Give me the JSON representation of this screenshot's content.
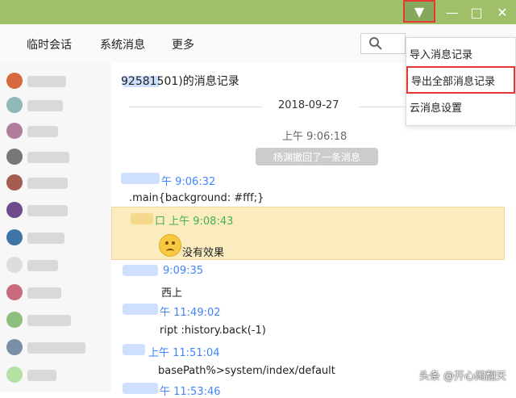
{
  "toolbar": {
    "tabs": [
      "临时会话",
      "系统消息",
      "更多"
    ]
  },
  "chat": {
    "title": "92581501)的消息记录",
    "date": "2018-09-27",
    "recall_time": "上午 9:06:18",
    "recall_text": "杨渊撤回了一条消息",
    "messages": [
      {
        "time": "午 9:06:32",
        "text": ".main{background: #fff;}"
      },
      {
        "time": "口 上午 9:08:43",
        "text": "没有效果",
        "highlight": true
      },
      {
        "time": "9:09:35",
        "text": "西上"
      },
      {
        "time": "午 11:49:02",
        "text": "ript :history.back(-1)"
      },
      {
        "time": "上午 11:51:04",
        "text": "basePath%>system/index/default"
      },
      {
        "time": "午 11:53:46",
        "text": ""
      }
    ]
  },
  "menu": {
    "items": [
      "导入消息记录",
      "导出全部消息记录",
      "云消息设置"
    ]
  },
  "watermark": "头条 @开心闹翻天",
  "icons": {
    "dropdown": "dropdown-arrow-icon",
    "minimize": "minimize-icon",
    "maximize": "maximize-icon",
    "close": "close-icon",
    "search": "search-icon"
  }
}
